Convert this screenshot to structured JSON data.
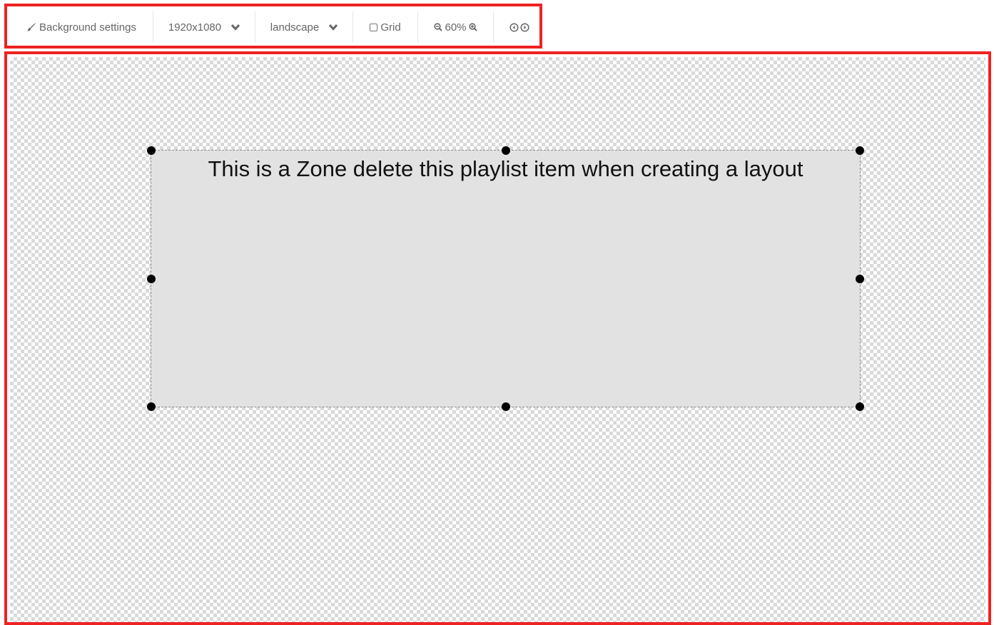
{
  "toolbar": {
    "background_settings_label": "Background settings",
    "resolution": "1920x1080",
    "orientation": "landscape",
    "grid_label": "Grid",
    "grid_checked": false,
    "zoom_level": "60%",
    "icons": {
      "background": "brush-icon",
      "resolution_dropdown": "chevron-down-icon",
      "orientation_dropdown": "chevron-down-icon",
      "zoom_out": "zoom-out-icon",
      "zoom_in": "zoom-in-icon",
      "nav_prev": "circle-arrow-left-icon",
      "nav_next": "circle-arrow-right-icon"
    }
  },
  "canvas": {
    "zone": {
      "text": "This is a Zone delete this playlist item when creating a layout"
    }
  },
  "colors": {
    "highlight": "#ee2222",
    "zone_background": "#e2e2e2",
    "toolbar_text": "#666666"
  }
}
